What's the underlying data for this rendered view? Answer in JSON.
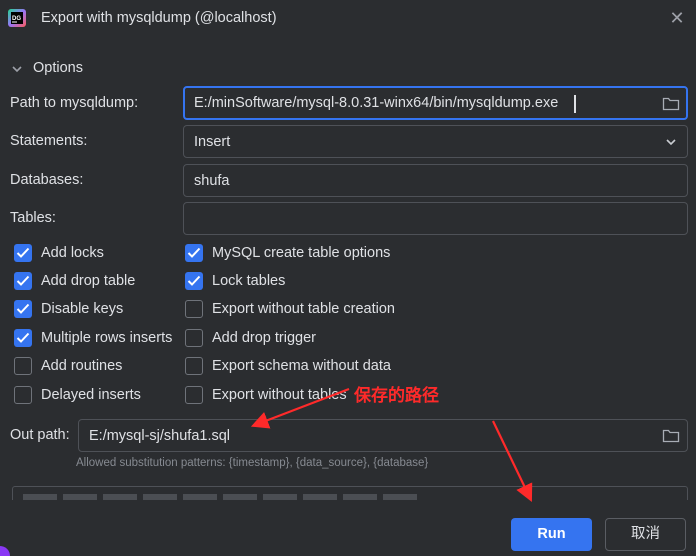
{
  "window": {
    "title": "Export with mysqldump (@localhost)"
  },
  "options": {
    "section_title": "Options",
    "path_label": "Path to mysqldump:",
    "path_value": "E:/minSoftware/mysql-8.0.31-winx64/bin/mysqldump.exe",
    "statements_label": "Statements:",
    "statements_value": "Insert",
    "databases_label": "Databases:",
    "databases_value": "shufa",
    "tables_label": "Tables:",
    "tables_value": ""
  },
  "checkboxes": {
    "left": [
      {
        "label": "Add locks",
        "checked": true
      },
      {
        "label": "Add drop table",
        "checked": true
      },
      {
        "label": "Disable keys",
        "checked": true
      },
      {
        "label": "Multiple rows inserts",
        "checked": true
      },
      {
        "label": "Add routines",
        "checked": false
      },
      {
        "label": "Delayed inserts",
        "checked": false
      }
    ],
    "right": [
      {
        "label": "MySQL create table options",
        "checked": true
      },
      {
        "label": "Lock tables",
        "checked": true
      },
      {
        "label": "Export without table creation",
        "checked": false
      },
      {
        "label": "Add drop trigger",
        "checked": false
      },
      {
        "label": "Export schema without data",
        "checked": false
      },
      {
        "label": "Export without tables",
        "checked": false
      }
    ]
  },
  "output": {
    "out_path_label": "Out path:",
    "out_path_value": "E:/mysql-sj/shufa1.sql",
    "hint": "Allowed substitution patterns: {timestamp}, {data_source}, {database}"
  },
  "buttons": {
    "run": "Run",
    "cancel": "取消"
  },
  "annotation": {
    "text": "保存的路径"
  },
  "colors": {
    "accent": "#3574f0",
    "background": "#2b2d30",
    "annotation": "#ff2a2a"
  }
}
